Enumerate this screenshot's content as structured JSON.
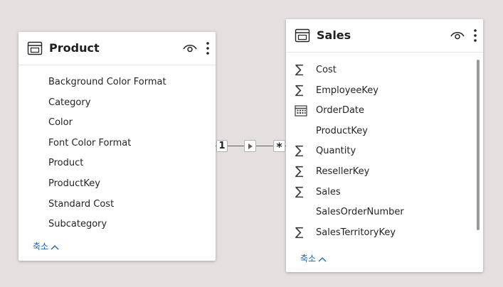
{
  "product_table": {
    "title": "Product",
    "fields": [
      {
        "label": "Background Color Format",
        "icon": "none"
      },
      {
        "label": "Category",
        "icon": "none"
      },
      {
        "label": "Color",
        "icon": "none"
      },
      {
        "label": "Font Color Format",
        "icon": "none"
      },
      {
        "label": "Product",
        "icon": "none"
      },
      {
        "label": "ProductKey",
        "icon": "none"
      },
      {
        "label": "Standard Cost",
        "icon": "none"
      },
      {
        "label": "Subcategory",
        "icon": "none"
      }
    ],
    "collapse_label": "축소"
  },
  "sales_table": {
    "title": "Sales",
    "fields": [
      {
        "label": "Cost",
        "icon": "sigma"
      },
      {
        "label": "EmployeeKey",
        "icon": "sigma"
      },
      {
        "label": "OrderDate",
        "icon": "calendar"
      },
      {
        "label": "ProductKey",
        "icon": "none"
      },
      {
        "label": "Quantity",
        "icon": "sigma"
      },
      {
        "label": "ResellerKey",
        "icon": "sigma"
      },
      {
        "label": "Sales",
        "icon": "sigma"
      },
      {
        "label": "SalesOrderNumber",
        "icon": "none"
      },
      {
        "label": "SalesTerritoryKey",
        "icon": "sigma"
      }
    ],
    "collapse_label": "축소"
  },
  "relationship": {
    "from_cardinality": "1",
    "to_cardinality": "*",
    "direction": "single"
  },
  "colors": {
    "canvas": "#e6dfdf",
    "card": "#ffffff",
    "link": "#1763b1",
    "text": "#252423"
  }
}
